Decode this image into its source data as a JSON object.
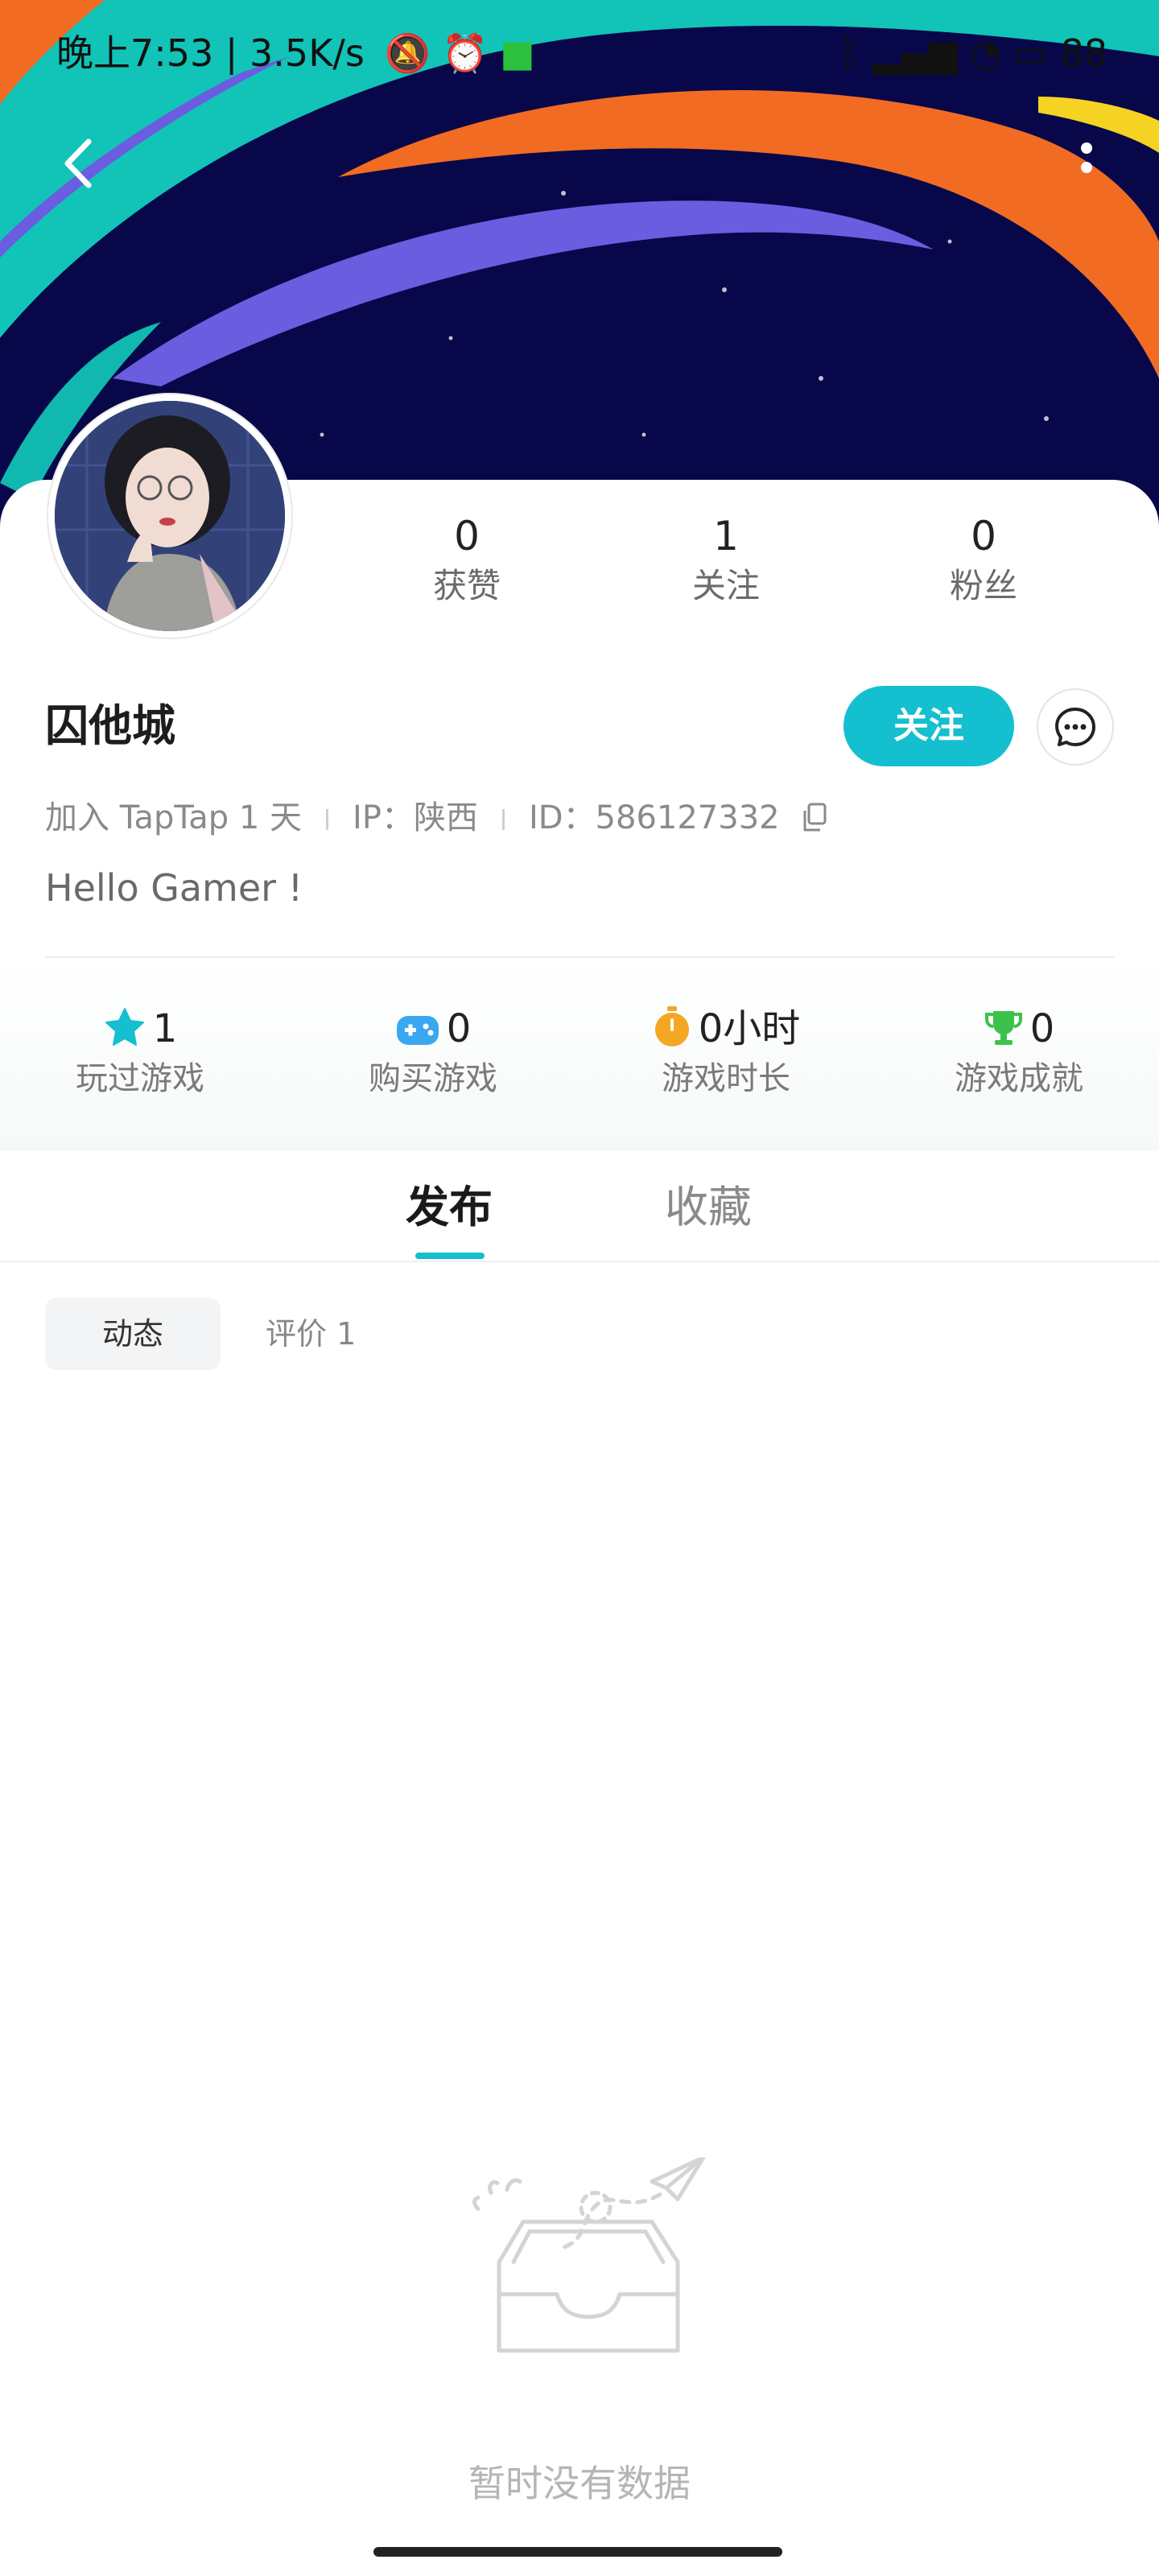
{
  "status_bar": {
    "time_speed": "晚上7:53 | 3.5K/s",
    "battery": "88"
  },
  "profile": {
    "username": "囚他城",
    "stats": [
      {
        "value": "0",
        "label": "获赞"
      },
      {
        "value": "1",
        "label": "关注"
      },
      {
        "value": "0",
        "label": "粉丝"
      }
    ],
    "follow_button": "关注",
    "meta": {
      "joined": "加入 TapTap 1 天",
      "ip": "IP：陕西",
      "id": "ID：586127332"
    },
    "bio": "Hello Gamer !"
  },
  "game_stats": [
    {
      "value": "1",
      "label": "玩过游戏",
      "icon": "star-icon",
      "color": "#14bfcf"
    },
    {
      "value": "0",
      "label": "购买游戏",
      "icon": "gamepad-icon",
      "color": "#3aa8f0"
    },
    {
      "value": "0小时",
      "label": "游戏时长",
      "icon": "stopwatch-icon",
      "color": "#f5a623"
    },
    {
      "value": "0",
      "label": "游戏成就",
      "icon": "trophy-icon",
      "color": "#3cc24a"
    }
  ],
  "tabs": {
    "publish": "发布",
    "collect": "收藏"
  },
  "sub_tabs": {
    "dynamic": "动态",
    "review": "评价 1"
  },
  "empty_state": {
    "text": "暂时没有数据"
  },
  "colors": {
    "accent": "#14bfcf"
  }
}
